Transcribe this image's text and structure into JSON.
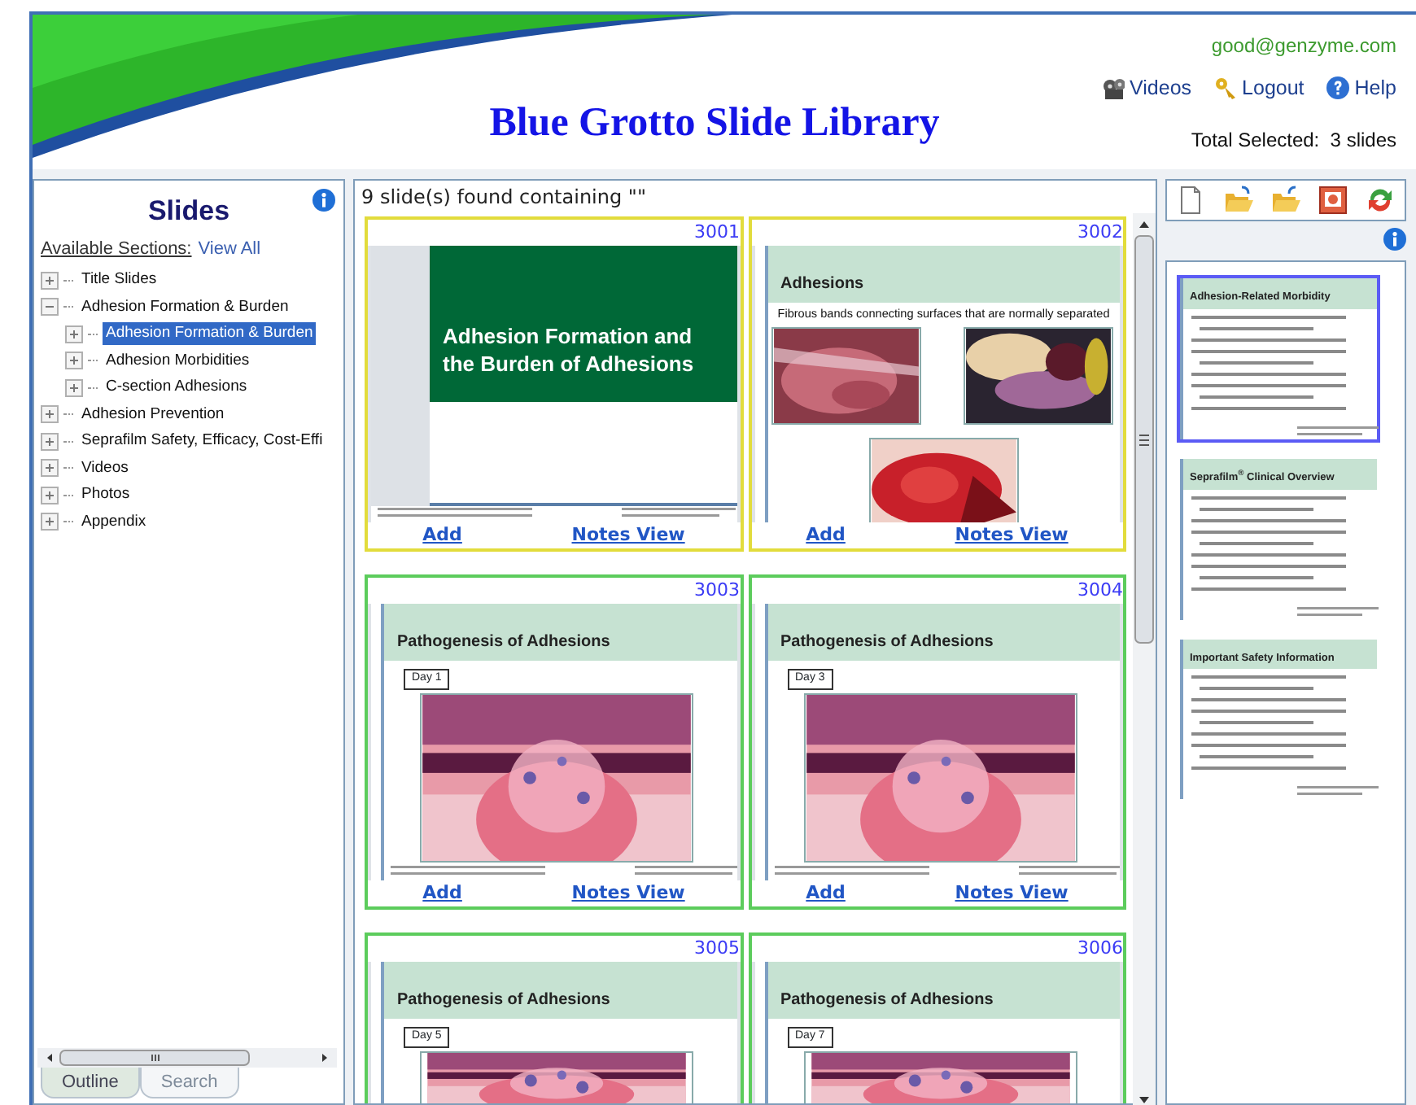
{
  "header": {
    "user_email": "good@genzyme.com",
    "links": [
      {
        "label": "Videos",
        "kind": "videos"
      },
      {
        "label": "Logout",
        "kind": "logout"
      },
      {
        "label": "Help",
        "kind": "help"
      }
    ],
    "title": "Blue Grotto Slide Library",
    "total_selected": "Total Selected:  3 slides"
  },
  "outline": {
    "title": "Slides",
    "sections_label": "Available Sections:",
    "view_all": "View All",
    "tree": [
      {
        "label": "Title Slides",
        "expanded": false,
        "selected": false
      },
      {
        "label": "Adhesion Formation & Burden",
        "expanded": true,
        "selected": false,
        "children": [
          {
            "label": "Adhesion Formation & Burden",
            "expanded": false,
            "selected": true
          },
          {
            "label": "Adhesion Morbidities",
            "expanded": false,
            "selected": false
          },
          {
            "label": "C-section Adhesions",
            "expanded": false,
            "selected": false
          }
        ]
      },
      {
        "label": "Adhesion Prevention",
        "expanded": false,
        "selected": false
      },
      {
        "label": "Seprafilm Safety, Efficacy, Cost-Effi",
        "expanded": false,
        "selected": false
      },
      {
        "label": "Videos",
        "expanded": false,
        "selected": false
      },
      {
        "label": "Photos",
        "expanded": false,
        "selected": false
      },
      {
        "label": "Appendix",
        "expanded": false,
        "selected": false
      }
    ],
    "tabs": [
      {
        "label": "Outline",
        "selected": true
      },
      {
        "label": "Search",
        "selected": false
      }
    ]
  },
  "results": {
    "summary": "9 slide(s) found containing \"\"",
    "slides": [
      {
        "number": "3001",
        "color": "#e2dc3c",
        "kind": "title",
        "title": "Adhesion Formation and the Burden of Adhesions",
        "links": [
          "Add",
          "Notes View"
        ]
      },
      {
        "number": "3002",
        "color": "#e2dc3c",
        "kind": "photos",
        "title": "Adhesions",
        "caption": "Fibrous bands connecting surfaces that are normally separated",
        "links": [
          "Add",
          "Notes View"
        ]
      },
      {
        "number": "3003",
        "color": "#5ccc5c",
        "kind": "diagram",
        "title": "Pathogenesis of Adhesions",
        "day": "Day 1",
        "links": [
          "Add",
          "Notes View"
        ]
      },
      {
        "number": "3004",
        "color": "#5ccc5c",
        "kind": "diagram",
        "title": "Pathogenesis of Adhesions",
        "day": "Day 3",
        "links": [
          "Add",
          "Notes View"
        ]
      },
      {
        "number": "3005",
        "color": "#5ccc5c",
        "kind": "diagram",
        "title": "Pathogenesis of Adhesions",
        "day": "Day 5"
      },
      {
        "number": "3006",
        "color": "#5ccc5c",
        "kind": "diagram",
        "title": "Pathogenesis of Adhesions",
        "day": "Day 7"
      }
    ]
  },
  "selection": {
    "toolbar": [
      {
        "kind": "new"
      },
      {
        "kind": "open"
      },
      {
        "kind": "save"
      },
      {
        "kind": "present"
      },
      {
        "kind": "refresh"
      }
    ],
    "slides": [
      {
        "title": "Adhesion-Related Morbidity",
        "selected": true
      },
      {
        "title": "Seprafilm$^{®}$ Clinical Overview",
        "selected": false
      },
      {
        "title": "Important Safety Information",
        "selected": false
      }
    ]
  }
}
